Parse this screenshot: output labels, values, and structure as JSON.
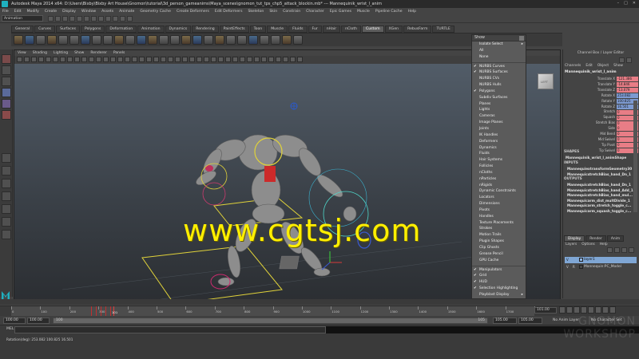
{
  "window": {
    "title": "Autodesk Maya 2014 x64: D:\\Users\\Bixby\\Bixby Art House\\Gnomon\\tutorial\\3d_person_gameanims\\Maya_scenes\\gnomon_tut_tps_chp5_attack_blockin.mb* --- Mannequinik_wrist_l_anim",
    "controls": [
      "–",
      "□",
      "✕"
    ]
  },
  "menubar": [
    "File",
    "Edit",
    "Modify",
    "Create",
    "Display",
    "Window",
    "Assets",
    "Animate",
    "Geometry Cache",
    "Create Deformers",
    "Edit Deformers",
    "Skeleton",
    "Skin",
    "Constrain",
    "Character",
    "Epic Games",
    "Muscle",
    "Pipeline Cache",
    "Help"
  ],
  "status": {
    "mode": "Animation"
  },
  "shelf": {
    "tabs": [
      "General",
      "Curves",
      "Surfaces",
      "Polygons",
      "Deformation",
      "Animation",
      "Dynamics",
      "Rendering",
      "PaintEffects",
      "Toon",
      "Muscle",
      "Fluids",
      "Fur",
      "nHair",
      "nCloth",
      "Custom",
      "XGen",
      "RebusFarm",
      "TURTLE"
    ],
    "active": "Custom"
  },
  "viewport": {
    "menu": [
      "View",
      "Shading",
      "Lighting",
      "Show",
      "Renderer",
      "Panels"
    ],
    "viewcube_label": "LEFT"
  },
  "watermark": {
    "text": "www.cgtsj.com",
    "color": "#ffef00"
  },
  "show_menu": {
    "title": "Show",
    "items": [
      {
        "label": "Isolate Select",
        "check": false,
        "arrow": true
      },
      {
        "label": "All",
        "check": false
      },
      {
        "label": "None",
        "check": false
      },
      {
        "sep": true
      },
      {
        "label": "NURBS Curves",
        "check": true
      },
      {
        "label": "NURBS Surfaces",
        "check": true
      },
      {
        "label": "NURBS CVs",
        "check": false
      },
      {
        "label": "NURBS Hulls",
        "check": false
      },
      {
        "label": "Polygons",
        "check": true
      },
      {
        "label": "Subdiv Surfaces",
        "check": false
      },
      {
        "label": "Planes",
        "check": false
      },
      {
        "label": "Lights",
        "check": false
      },
      {
        "label": "Cameras",
        "check": false
      },
      {
        "label": "Image Planes",
        "check": false
      },
      {
        "label": "Joints",
        "check": false
      },
      {
        "label": "IK Handles",
        "check": false
      },
      {
        "label": "Deformers",
        "check": false
      },
      {
        "label": "Dynamics",
        "check": false
      },
      {
        "label": "Fluids",
        "check": false
      },
      {
        "label": "Hair Systems",
        "check": false
      },
      {
        "label": "Follicles",
        "check": false
      },
      {
        "label": "nCloths",
        "check": false
      },
      {
        "label": "nParticles",
        "check": false
      },
      {
        "label": "nRigids",
        "check": false
      },
      {
        "label": "Dynamic Constraints",
        "check": false
      },
      {
        "label": "Locators",
        "check": false
      },
      {
        "label": "Dimensions",
        "check": false
      },
      {
        "label": "Pivots",
        "check": false
      },
      {
        "label": "Handles",
        "check": false
      },
      {
        "label": "Texture Placements",
        "check": false
      },
      {
        "label": "Strokes",
        "check": false
      },
      {
        "label": "Motion Trails",
        "check": false
      },
      {
        "label": "Plugin Shapes",
        "check": false
      },
      {
        "label": "Clip Ghosts",
        "check": false
      },
      {
        "label": "Grease Pencil",
        "check": false
      },
      {
        "label": "GPU Cache",
        "check": false
      },
      {
        "sep": true
      },
      {
        "label": "Manipulators",
        "check": true
      },
      {
        "label": "Grid",
        "check": true
      },
      {
        "label": "HUD",
        "check": true
      },
      {
        "label": "Selection Highlighting",
        "check": true
      },
      {
        "label": "Playblast Display",
        "check": false,
        "arrow": true
      }
    ]
  },
  "channel_box": {
    "header": "Channel Box / Layer Editor",
    "menu": [
      "Channels",
      "Edit",
      "Object",
      "Show"
    ],
    "object": "Mannequinik_wrist_l_anim",
    "attrs": [
      {
        "name": "Translate X",
        "value": "-121.386",
        "color": "#e87d86"
      },
      {
        "name": "Translate Y",
        "value": "-14.846",
        "color": "#e87d86"
      },
      {
        "name": "Translate Z",
        "value": "-13.079",
        "color": "#e87d86"
      },
      {
        "name": "Rotate X",
        "value": "253.082",
        "color": "#7d9ad1"
      },
      {
        "name": "Rotate Y",
        "value": "100.825",
        "color": "#7d9ad1"
      },
      {
        "name": "Rotate Z",
        "value": "16.501",
        "color": "#7d9ad1"
      },
      {
        "name": "Stretch",
        "value": "0",
        "color": "#e87d86"
      },
      {
        "name": "Squash",
        "value": "0",
        "color": "#e87d86"
      },
      {
        "name": "Stretch Bias",
        "value": "0",
        "color": "#e87d86"
      },
      {
        "name": "Side",
        "value": "0",
        "color": "#e87d86"
      },
      {
        "name": "Mid Bend",
        "value": "0",
        "color": "#e87d86"
      },
      {
        "name": "Mid Swivel",
        "value": "0",
        "color": "#e87d86"
      },
      {
        "name": "Tip Pivot",
        "value": "0",
        "color": "#e87d86"
      },
      {
        "name": "Tip Swivel",
        "value": "0",
        "color": "#e87d86"
      }
    ],
    "shapes_label": "SHAPES",
    "shape": "Mannequinik_wrist_l_animShape",
    "inputs_label": "INPUTS",
    "inputs": [
      "MannequiextransformGeometry30",
      "MannequicstretchBias_hand_Dn_1",
      "MannequicstretchBias_hand_Add_1",
      "MannequicstretchBias_hand_mul..."
    ],
    "outputs_label": "OUTPUTS",
    "outputs": [
      "MannequicstretchBias_hand_Dn_1",
      "MannequicstretchBias_hand_Add_1",
      "MannequicstretchBias_hand_mul...",
      "Mannequicarm_dist_multDivide_1",
      "Mannequicarm_stretch_toggle_c...",
      "Mannequicarm_squash_toggle_c..."
    ]
  },
  "layer_editor": {
    "tabs": [
      "Display",
      "Render",
      "Anim"
    ],
    "active": "Display",
    "menu": [
      "Layers",
      "Options",
      "Help"
    ],
    "layers": [
      {
        "v": "V",
        "r": "",
        "name": "layer1",
        "swatch": "#8fb4e0",
        "selected": true
      },
      {
        "v": "V",
        "r": "R",
        "name": "Mannequin:PC_Model",
        "swatch": "#4a4a4a",
        "selected": false
      }
    ]
  },
  "timeline": {
    "ticks": [
      "0",
      "100",
      "200",
      "300",
      "400",
      "500",
      "600",
      "700",
      "800",
      "900",
      "1000",
      "1100",
      "1200",
      "1300",
      "1400",
      "1500",
      "1600",
      "1700",
      "1800"
    ],
    "current_label": "101",
    "current_frame": "101.00"
  },
  "range": {
    "start": "100.00",
    "anim_start": "100.00",
    "slider_start": "100",
    "slider_end": "105",
    "anim_end": "105.00",
    "end": "105.00",
    "anim_layer": "No Anim Layer",
    "char_set": "No Character Set"
  },
  "command": {
    "label": "MEL"
  },
  "help": {
    "text": "Rotation(deg):   253.082   100.825   16.501"
  },
  "watermark2": {
    "line1": "GNOMON",
    "line2": "WORKSHOP"
  }
}
